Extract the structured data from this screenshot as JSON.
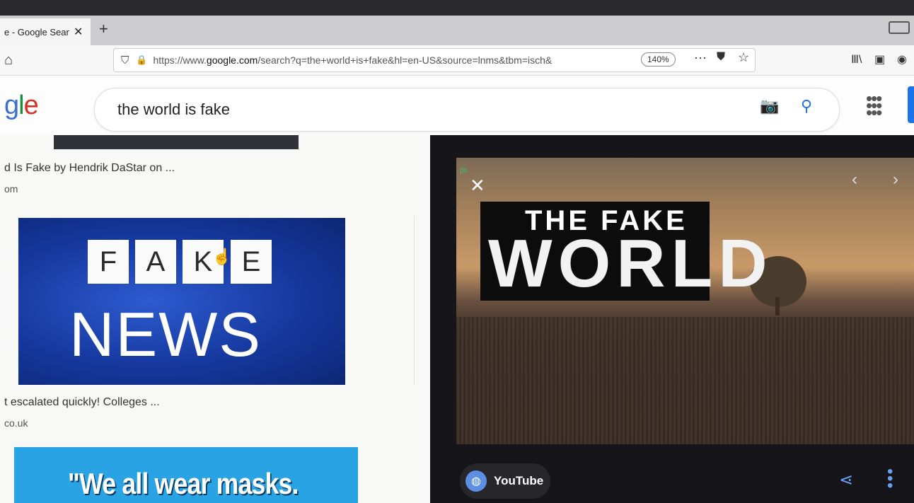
{
  "browser": {
    "tab_title": "e - Google Sear",
    "tab_close": "✕",
    "new_tab": "+",
    "url_prefix": "https://www.",
    "url_domain": "google.com",
    "url_path": "/search?q=the+world+is+fake&hl=en-US&source=lnms&tbm=isch&",
    "zoom": "140%",
    "menu": "···"
  },
  "google": {
    "logo_part1": "g",
    "logo_part2": "l",
    "logo_part3": "e",
    "query": "the world is fake"
  },
  "results": [
    {
      "title": "d Is Fake by Hendrik DaStar on ...",
      "source": "om"
    },
    {
      "title": "t escalated quickly! Colleges ...",
      "source": "co.uk"
    }
  ],
  "fake_news_image": {
    "cards": [
      "F",
      "A",
      "K",
      "E"
    ],
    "word": "NEWS"
  },
  "masks_image": {
    "text": "\"We all wear masks."
  },
  "preview": {
    "badge": "p̈̈̈s",
    "title_line1": "THE FAKE",
    "title_line2": "WORLD",
    "source_label": "YouTube"
  },
  "colors": {
    "google_blue": "#1a73e8",
    "panel_bg": "#16161a"
  }
}
